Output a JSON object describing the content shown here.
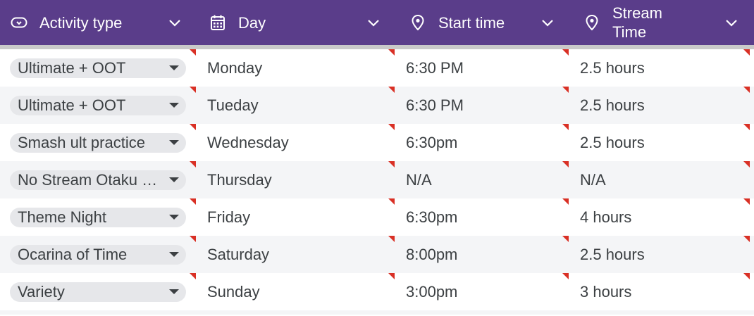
{
  "columns": [
    {
      "label": "Activity type",
      "icon": "dropdown-chip-icon"
    },
    {
      "label": "Day",
      "icon": "calendar-icon"
    },
    {
      "label": "Start time",
      "icon": "location-pin-icon"
    },
    {
      "label": "Stream Time",
      "icon": "location-pin-icon"
    }
  ],
  "colors": {
    "header_bg": "#5a3d8a",
    "header_text": "#ffffff",
    "row_alt": "#f4f5f7",
    "chip_bg": "#e6e7ea",
    "note_marker": "#d93025"
  },
  "rows": [
    {
      "activity": "Ultimate + OOT",
      "day": "Monday",
      "start": "6:30 PM",
      "stream": "2.5 hours"
    },
    {
      "activity": "Ultimate + OOT",
      "day": "Tueday",
      "start": "6:30 PM",
      "stream": "2.5 hours"
    },
    {
      "activity": "Smash ult practice",
      "day": "Wednesday",
      "start": "6:30pm",
      "stream": "2.5 hours"
    },
    {
      "activity": "No Stream Otaku Night",
      "day": "Thursday",
      "start": "N/A",
      "stream": "N/A"
    },
    {
      "activity": "Theme Night",
      "day": "Friday",
      "start": "6:30pm",
      "stream": "4 hours"
    },
    {
      "activity": "Ocarina of Time",
      "day": "Saturday",
      "start": "8:00pm",
      "stream": "2.5 hours"
    },
    {
      "activity": "Variety",
      "day": "Sunday",
      "start": "3:00pm",
      "stream": "3 hours"
    }
  ]
}
